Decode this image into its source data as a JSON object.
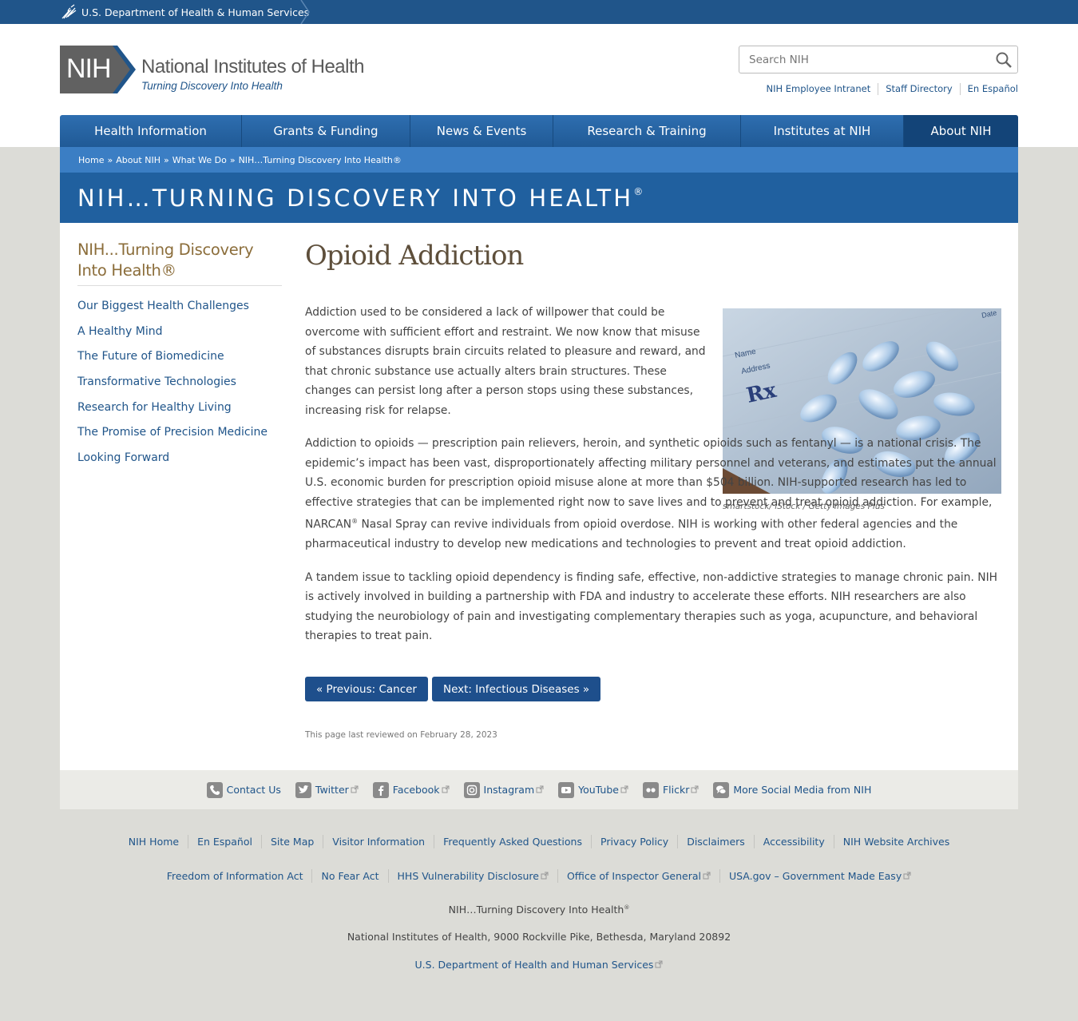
{
  "hhs_bar": {
    "label": "U.S. Department of Health & Human Services"
  },
  "header": {
    "logo_mark": "NIH",
    "org_name": "National Institutes of Health",
    "tagline": "Turning Discovery Into Health",
    "search_placeholder": "Search NIH",
    "utility_links": [
      "NIH Employee Intranet",
      "Staff Directory",
      "En Español"
    ]
  },
  "nav": {
    "items": [
      "Health Information",
      "Grants & Funding",
      "News & Events",
      "Research & Training",
      "Institutes at NIH",
      "About NIH"
    ],
    "active": "About NIH"
  },
  "breadcrumb": [
    "Home",
    "About NIH",
    "What We Do",
    "NIH…Turning Discovery Into Health®"
  ],
  "banner": {
    "title": "NIH…TURNING DISCOVERY INTO HEALTH",
    "mark": "®"
  },
  "sidebar": {
    "title": "NIH...Turning Discovery Into Health®",
    "items": [
      "Our Biggest Health Challenges",
      "A Healthy Mind",
      "The Future of Biomedicine",
      "Transformative Technologies",
      "Research for Healthy Living",
      "The Promise of Precision Medicine",
      "Looking Forward"
    ]
  },
  "article": {
    "title": "Opioid Addiction",
    "image_caption": "smartstock/ iStock / Getty Images Plus",
    "image_labels": {
      "date": "Date",
      "name": "Name",
      "address": "Address",
      "rx": "Rx"
    },
    "paragraphs": [
      "Addiction used to be considered a lack of willpower that could be overcome with sufficient effort and restraint. We now know that misuse of substances disrupts brain circuits related to pleasure and reward, and that chronic substance use actually alters brain structures. These changes can persist long after a person stops using these substances, increasing risk for relapse.",
      "Addiction to opioids — prescription pain relievers, heroin, and synthetic opioids such as fentanyl — is a national crisis. The epidemic’s impact has been vast, disproportionately affecting military personnel and veterans, and estimates put the annual U.S. economic burden for prescription opioid misuse alone at more than $504 billion. NIH-supported research has led to effective strategies that can be implemented right now to save lives and to prevent and treat opioid addiction. For example, NARCAN",
      " Nasal Spray can revive individuals from opioid overdose. NIH is working with other federal agencies and the pharmaceutical industry to develop new medications and technologies to prevent and treat opioid addiction.",
      "A tandem issue to tackling opioid dependency is finding safe, effective, non-addictive strategies to manage chronic pain. NIH is actively involved in building a partnership with FDA and industry to accelerate these efforts. NIH researchers are also studying the neurobiology of pain and investigating complementary therapies such as yoga, acupuncture, and behavioral therapies to treat pain."
    ],
    "registered_mark": "®",
    "prev_label": "« Previous: Cancer",
    "next_label": "Next: Infectious Diseases »",
    "reviewed": "This page last reviewed on February 28, 2023"
  },
  "social": [
    "Contact Us",
    "Twitter",
    "Facebook",
    "Instagram",
    "YouTube",
    "Flickr",
    "More Social Media from NIH"
  ],
  "footer": {
    "row1": [
      "NIH Home",
      "En Español",
      "Site Map",
      "Visitor Information",
      "Frequently Asked Questions",
      "Privacy Policy",
      "Disclaimers",
      "Accessibility",
      "NIH Website Archives"
    ],
    "row2": [
      "Freedom of Information Act",
      "No Fear Act",
      "HHS Vulnerability Disclosure",
      "Office of Inspector General",
      "USA.gov – Government Made Easy"
    ],
    "tagline": "NIH…Turning Discovery Into Health",
    "tagline_mark": "®",
    "address": "National Institutes of Health, 9000 Rockville Pike, Bethesda, Maryland 20892",
    "hhs_link": "U.S. Department of Health and Human Services"
  },
  "colors": {
    "hhs_bar": "#20558a",
    "nav": "#2e6eb0",
    "nav_active": "#134478",
    "banner": "#20609f",
    "link": "#20558a",
    "sidebar_title": "#8b6d3a",
    "page_bg": "#dcdcd7"
  }
}
